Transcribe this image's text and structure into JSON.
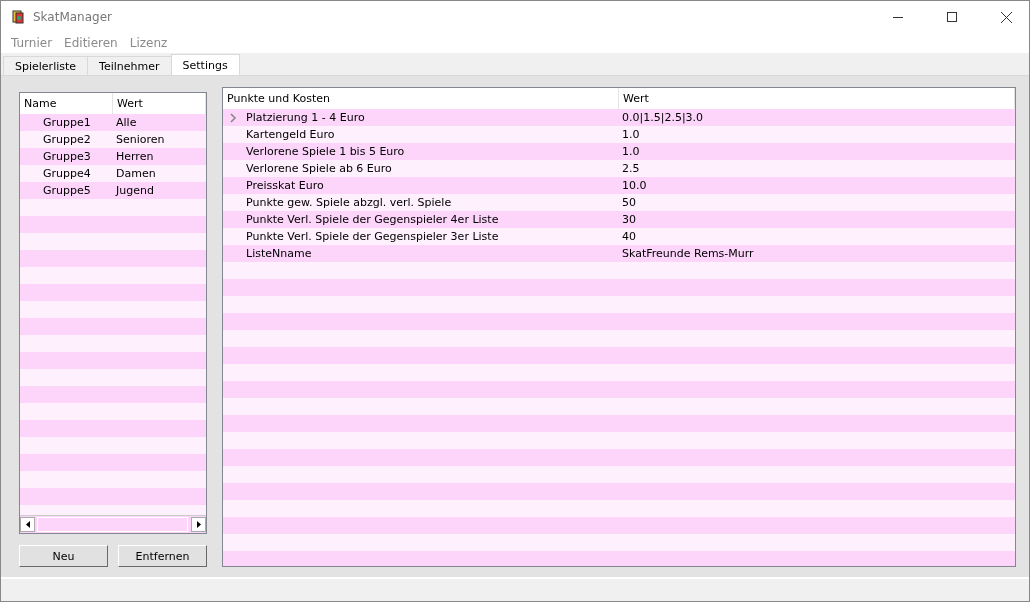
{
  "window": {
    "title": "SkatManager"
  },
  "menu": [
    "Turnier",
    "Editieren",
    "Lizenz"
  ],
  "tabs": [
    {
      "label": "Spielerliste",
      "selected": false
    },
    {
      "label": "Teilnehmer",
      "selected": false
    },
    {
      "label": "Settings",
      "selected": true
    }
  ],
  "groups": {
    "columns": [
      "Name",
      "Wert"
    ],
    "rows": [
      {
        "name": "Gruppe1",
        "value": "Alle"
      },
      {
        "name": "Gruppe2",
        "value": "Senioren"
      },
      {
        "name": "Gruppe3",
        "value": "Herren"
      },
      {
        "name": "Gruppe4",
        "value": "Damen"
      },
      {
        "name": "Gruppe5",
        "value": "Jugend"
      }
    ]
  },
  "buttons": [
    "Neu",
    "Entfernen"
  ],
  "settings": {
    "columns": [
      "Punkte und Kosten",
      "Wert"
    ],
    "rows": [
      {
        "kind": "group",
        "expanded": false,
        "name": "Platzierung 1 - 4 Euro",
        "value": "0.0|1.5|2.5|3.0"
      },
      {
        "kind": "item",
        "name": "Kartengeld Euro",
        "value": "1.0"
      },
      {
        "kind": "item",
        "name": "Verlorene Spiele 1 bis 5 Euro",
        "value": "1.0"
      },
      {
        "kind": "item",
        "name": "Verlorene Spiele ab 6 Euro",
        "value": "2.5"
      },
      {
        "kind": "item",
        "name": "Preisskat Euro",
        "value": "10.0"
      },
      {
        "kind": "item",
        "name": "Punkte gew. Spiele abzgl. verl. Spiele",
        "value": "50"
      },
      {
        "kind": "item",
        "name": "Punkte Verl. Spiele der Gegenspieler 4er Liste",
        "value": "30"
      },
      {
        "kind": "item",
        "name": "Punkte Verl. Spiele der Gegenspieler 3er Liste",
        "value": "40"
      },
      {
        "kind": "item",
        "name": "ListeNname",
        "value": "SkatFreunde Rems-Murr"
      }
    ]
  }
}
